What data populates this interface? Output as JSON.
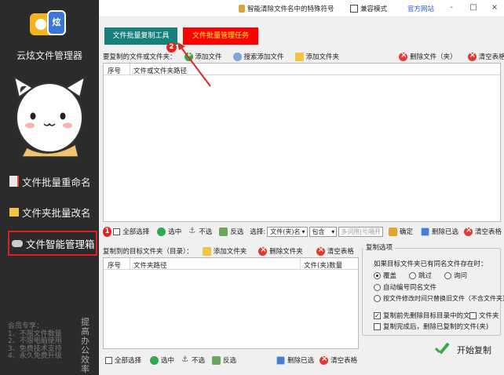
{
  "sidebar": {
    "app_name": "云炫文件管理器",
    "logo_badge": "炫",
    "nav": [
      {
        "label": "文件批量重命名",
        "icon": "document-icon"
      },
      {
        "label": "文件夹批量改名",
        "icon": "folder-icon"
      },
      {
        "label": "文件智能管理箱",
        "icon": "gamepad-icon",
        "active": true
      }
    ],
    "member_title": "会员专享：",
    "member_perks": [
      "1、不限文件数量",
      "2、不限电脑使用",
      "3、免费技术支持",
      "4、永久免费升级"
    ],
    "slogan": "提高办公效率"
  },
  "titlebar": {
    "special_chars": "智能清除文件名中的特殊符号",
    "compat_mode": "兼容模式",
    "official_site": "官方网站",
    "minimize": "-",
    "maximize": "□",
    "close": "×"
  },
  "tabs": {
    "copy_tool": "文件批量复制工具",
    "task_manager": "文件批量管理任务"
  },
  "source": {
    "label": "要复制的文件或文件夹：",
    "add_file": "添加文件",
    "search_add": "搜索添加文件",
    "add_folder": "添加文件夹",
    "delete_file": "删除文件（夹）",
    "clear_table": "清空表格",
    "col_no": "序号",
    "col_path": "文件或文件夹路径"
  },
  "filter": {
    "select_all": "全部选择",
    "select": "选中",
    "deselect": "不选",
    "invert": "反选",
    "choose": "选择:",
    "field_value": "文件(夹)名",
    "mode_value": "包含",
    "placeholder": "多词用|号隔开",
    "confirm": "确定",
    "delete_selected": "删除已选",
    "clear_table": "清空表格"
  },
  "target": {
    "label": "复制到的目标文件夹（目录）：",
    "add_folder": "添加文件夹",
    "delete_folder": "删除文件夹",
    "clear_table": "清空表格",
    "col_no": "序号",
    "col_path": "文件夹路径",
    "col_count": "文件(夹)数量"
  },
  "bottom_bar": {
    "select_all": "全部选择",
    "select": "选中",
    "deselect": "不选",
    "invert": "反选",
    "delete_selected": "删除已选",
    "clear_table": "清空表格"
  },
  "options": {
    "legend": "复制选项",
    "exists_label": "如果目标文件夹已有同名文件存在时：",
    "overwrite": "覆盖",
    "skip": "跳过",
    "ask": "询问",
    "auto_number": "自动编号同名文件",
    "by_time": "按文件修改时间只替换旧文件（不含文件夹）",
    "pre_delete": "复制前先删除目标目录中的文件",
    "folder": "文件夹",
    "post_delete": "复制完成后，删除已复制的文件(夹)"
  },
  "start_label": "开始复制",
  "markers": {
    "one": "1",
    "two": "2"
  }
}
